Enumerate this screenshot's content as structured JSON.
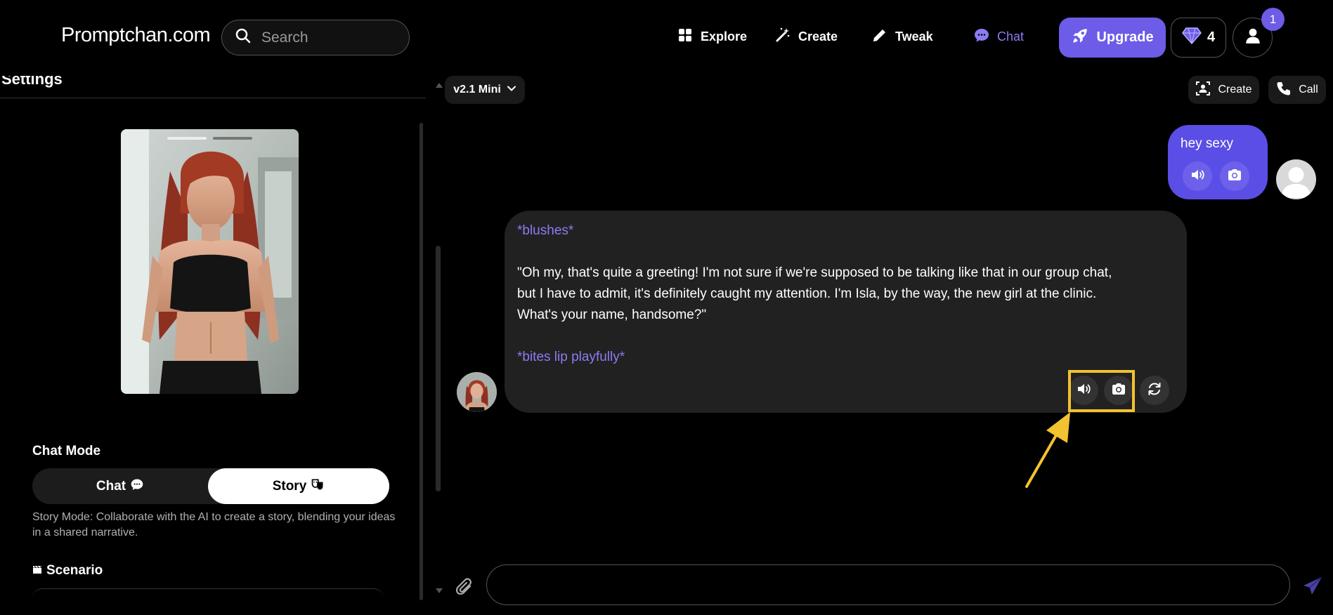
{
  "header": {
    "logo": "Promptchan.com",
    "search_placeholder": "Search",
    "nav": {
      "explore": "Explore",
      "create": "Create",
      "tweak": "Tweak",
      "chat": "Chat"
    },
    "upgrade_label": "Upgrade",
    "gems_count": "4",
    "notification_count": "1"
  },
  "sidebar": {
    "title": "Settings",
    "chat_mode_label": "Chat Mode",
    "mode_chat_label": "Chat",
    "mode_story_label": "Story",
    "mode_description": "Story Mode: Collaborate with the AI to create a story, blending your ideas in a shared narrative.",
    "scenario_label": "Scenario"
  },
  "chat": {
    "model_label": "v2.1 Mini",
    "create_label": "Create",
    "call_label": "Call",
    "messages": [
      {
        "role": "user",
        "text": "hey sexy"
      },
      {
        "role": "ai",
        "lines": [
          "*blushes*",
          "\"Oh my, that's quite a greeting! I'm not sure if we're supposed to be talking like that in our group chat,",
          "but I have to admit, it's definitely caught my attention. I'm Isla, by the way, the new girl at the clinic.",
          "What's your name, handsome?\"",
          "*bites lip playfully*"
        ]
      }
    ],
    "input_placeholder": ""
  },
  "colors": {
    "accent": "#6c5ce7",
    "user_bubble": "#5b4ee6",
    "ai_bubble": "#212121",
    "action_text": "#8a7cf4",
    "highlight": "#f2c230"
  },
  "icons": [
    "search-icon",
    "grid-icon",
    "magic-wand-icon",
    "pencil-icon",
    "chat-bubble-icon",
    "rocket-icon",
    "diamond-icon",
    "user-icon",
    "chevron-down-icon",
    "person-frame-icon",
    "phone-icon",
    "speaker-icon",
    "camera-icon",
    "refresh-icon",
    "paperclip-icon",
    "send-icon",
    "clapperboard-icon",
    "theater-masks-icon"
  ]
}
